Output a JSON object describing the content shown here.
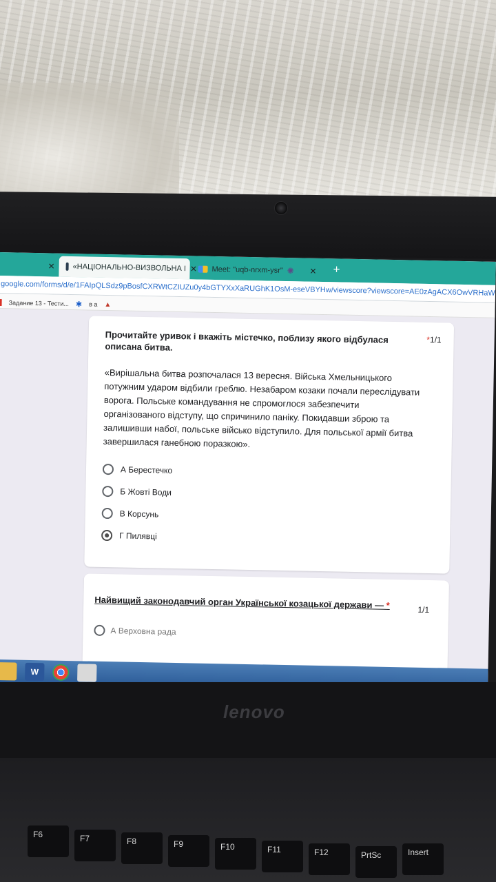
{
  "browser": {
    "tabs": [
      {
        "label": "",
        "active": false
      },
      {
        "label": "«НАЦІОНАЛЬНО-ВИЗВОЛЬНА І",
        "active": true
      },
      {
        "label": "Meet: \"uqb-nrxm-ysr\"",
        "active": false
      }
    ],
    "url": "google.com/forms/d/e/1FAIpQLSdz9pBosfCXRWtCZIUZu0y4bGTYXxXaRUGhK1OsM-eseVBYHw/viewscore?viewscore=AE0zAgACX6OwVRHaW",
    "bookmarks": [
      "Задание 13 - Тести...",
      "в а"
    ]
  },
  "question1": {
    "title": "Прочитайте уривок і вкажіть містечко, поблизу якого відбулася описана битва.",
    "required_mark": "*",
    "points": "1/1",
    "passage": "«Вирішальна битва розпочалася 13 вересня. Війська Хмельницького потужним ударом відбили греблю. Незабаром козаки почали переслідувати ворога. Польське командування не спромоглося забезпечити організованого відступу, що спричинило паніку. Покидавши зброю та залишивши набої, польське військо відступило. Для польської армії битва завершилася ганебною поразкою».",
    "options": [
      "А Берестечко",
      "Б Жовті Води",
      "В Корсунь",
      "Г Пилявці"
    ],
    "selected_index": 3
  },
  "question2": {
    "title": "Найвищий законодавчий орган Української козацької держави —",
    "required_mark": "*",
    "points": "1/1",
    "options": [
      "А Верховна рада"
    ]
  },
  "taskbar": {
    "word_label": "W"
  },
  "laptop": {
    "brand": "lenovo",
    "fkeys": [
      "F6",
      "F7",
      "F8",
      "F9",
      "F10",
      "F11",
      "F12",
      "PrtSc",
      "Insert"
    ]
  },
  "colors": {
    "tabbar": "#24a79a",
    "taskbar": "#2b5b97",
    "required": "#d93025"
  }
}
